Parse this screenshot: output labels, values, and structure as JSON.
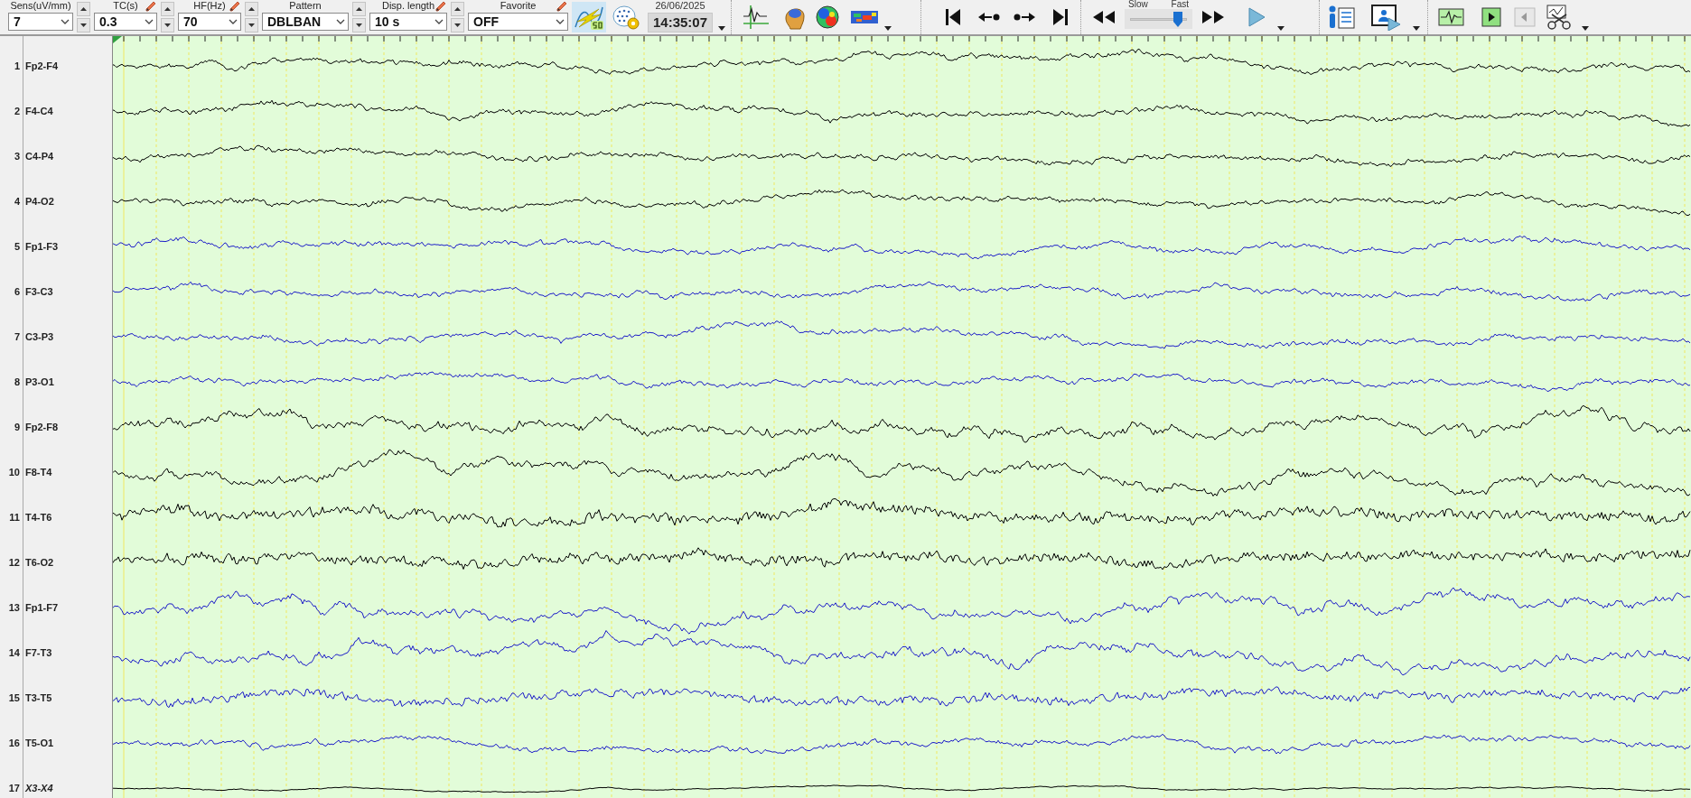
{
  "toolbar": {
    "selectors": [
      {
        "label": "Sens(uV/mm)",
        "value": "7",
        "editable": false,
        "spinner": true
      },
      {
        "label": "TC(s)",
        "value": "0.3",
        "editable": true,
        "spinner": true
      },
      {
        "label": "HF(Hz)",
        "value": "70",
        "editable": true,
        "spinner": true
      },
      {
        "label": "Pattern",
        "value": "DBLBAN",
        "editable": false,
        "spinner": true
      },
      {
        "label": "Disp. length",
        "value": "10 s",
        "editable": true,
        "spinner": true
      },
      {
        "label": "Favorite",
        "value": "OFF",
        "editable": true,
        "spinner": false
      }
    ],
    "date": "26/06/2025",
    "time": "14:35:07",
    "speed": {
      "slow_label": "Slow",
      "fast_label": "Fast",
      "level": 0.86
    },
    "step_back_button": {
      "disabled": true
    }
  },
  "channels": [
    {
      "number": "1",
      "name": "Fp2-F4",
      "color": "#000000",
      "kind": "derivation"
    },
    {
      "number": "2",
      "name": "F4-C4",
      "color": "#000000",
      "kind": "derivation"
    },
    {
      "number": "3",
      "name": "C4-P4",
      "color": "#000000",
      "kind": "derivation"
    },
    {
      "number": "4",
      "name": "P4-O2",
      "color": "#000000",
      "kind": "derivation"
    },
    {
      "number": "5",
      "name": "Fp1-F3",
      "color": "#1c1cc8",
      "kind": "derivation"
    },
    {
      "number": "6",
      "name": "F3-C3",
      "color": "#1c1cc8",
      "kind": "derivation"
    },
    {
      "number": "7",
      "name": "C3-P3",
      "color": "#1c1cc8",
      "kind": "derivation"
    },
    {
      "number": "8",
      "name": "P3-O1",
      "color": "#1c1cc8",
      "kind": "derivation"
    },
    {
      "number": "9",
      "name": "Fp2-F8",
      "color": "#000000",
      "kind": "derivation"
    },
    {
      "number": "10",
      "name": "F8-T4",
      "color": "#000000",
      "kind": "derivation"
    },
    {
      "number": "11",
      "name": "T4-T6",
      "color": "#000000",
      "kind": "derivation"
    },
    {
      "number": "12",
      "name": "T6-O2",
      "color": "#000000",
      "kind": "derivation"
    },
    {
      "number": "13",
      "name": "Fp1-F7",
      "color": "#1c1cc8",
      "kind": "derivation"
    },
    {
      "number": "14",
      "name": "F7-T3",
      "color": "#1c1cc8",
      "kind": "derivation"
    },
    {
      "number": "15",
      "name": "T3-T5",
      "color": "#1c1cc8",
      "kind": "derivation"
    },
    {
      "number": "16",
      "name": "T5-O1",
      "color": "#1c1cc8",
      "kind": "derivation"
    },
    {
      "number": "17",
      "name": "X3-X4",
      "color": "#000000",
      "kind": "auxiliary"
    }
  ]
}
